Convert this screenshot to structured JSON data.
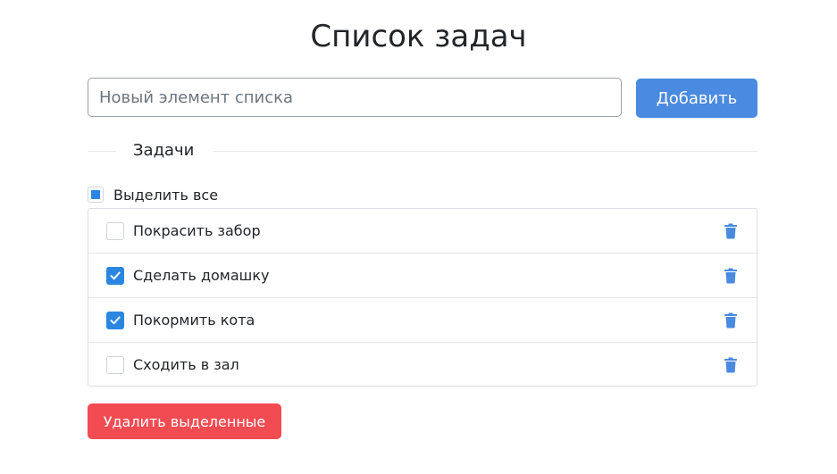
{
  "page": {
    "title": "Список задач"
  },
  "new_item": {
    "placeholder": "Новый элемент списка",
    "value": "",
    "add_label": "Добавить"
  },
  "section": {
    "legend": "Задачи"
  },
  "select_all": {
    "label": "Выделить все",
    "state": "indeterminate"
  },
  "tasks": [
    {
      "label": "Покрасить забор",
      "checked": false
    },
    {
      "label": "Сделать домашку",
      "checked": true
    },
    {
      "label": "Покормить кота",
      "checked": true
    },
    {
      "label": "Сходить в зал",
      "checked": false
    }
  ],
  "actions": {
    "delete_selected_label": "Удалить выделенные"
  },
  "colors": {
    "primary": "#4a8ae0",
    "check": "#2a86e0",
    "danger": "#f34b52"
  },
  "icons": {
    "delete": "trash-icon",
    "check": "checkmark-icon"
  }
}
